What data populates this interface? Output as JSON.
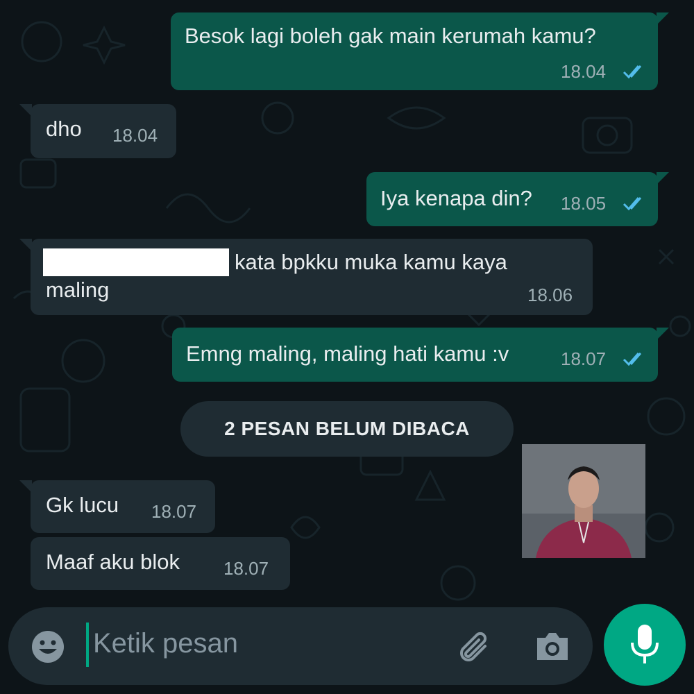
{
  "messages": [
    {
      "direction": "outgoing",
      "text": "Besok lagi boleh gak main kerumah kamu?",
      "time": "18.04",
      "status": "read"
    },
    {
      "direction": "incoming",
      "text": "dho",
      "time": "18.04"
    },
    {
      "direction": "outgoing",
      "text": "Iya kenapa din?",
      "time": "18.05",
      "status": "read"
    },
    {
      "direction": "incoming",
      "text_line1": "kata bpkku muka kamu kaya",
      "text_line2": "maling",
      "time": "18.06",
      "redacted": true
    },
    {
      "direction": "outgoing",
      "text": "Emng maling, maling hati kamu :v",
      "time": "18.07",
      "status": "read"
    }
  ],
  "unread_divider": "2 PESAN BELUM DIBACA",
  "unread_messages": [
    {
      "direction": "incoming",
      "text": "Gk lucu",
      "time": "18.07"
    },
    {
      "direction": "incoming",
      "text": "Maaf aku blok",
      "time": "18.07"
    }
  ],
  "composer": {
    "placeholder": "Ketik pesan",
    "icons": [
      "emoji-icon",
      "attach-icon",
      "camera-icon",
      "mic-icon"
    ]
  },
  "colors": {
    "background": "#0d1418",
    "outgoing_bubble": "#0b574a",
    "incoming_bubble": "#1f2c33",
    "read_ticks": "#53bdeb",
    "accent": "#00a884"
  }
}
